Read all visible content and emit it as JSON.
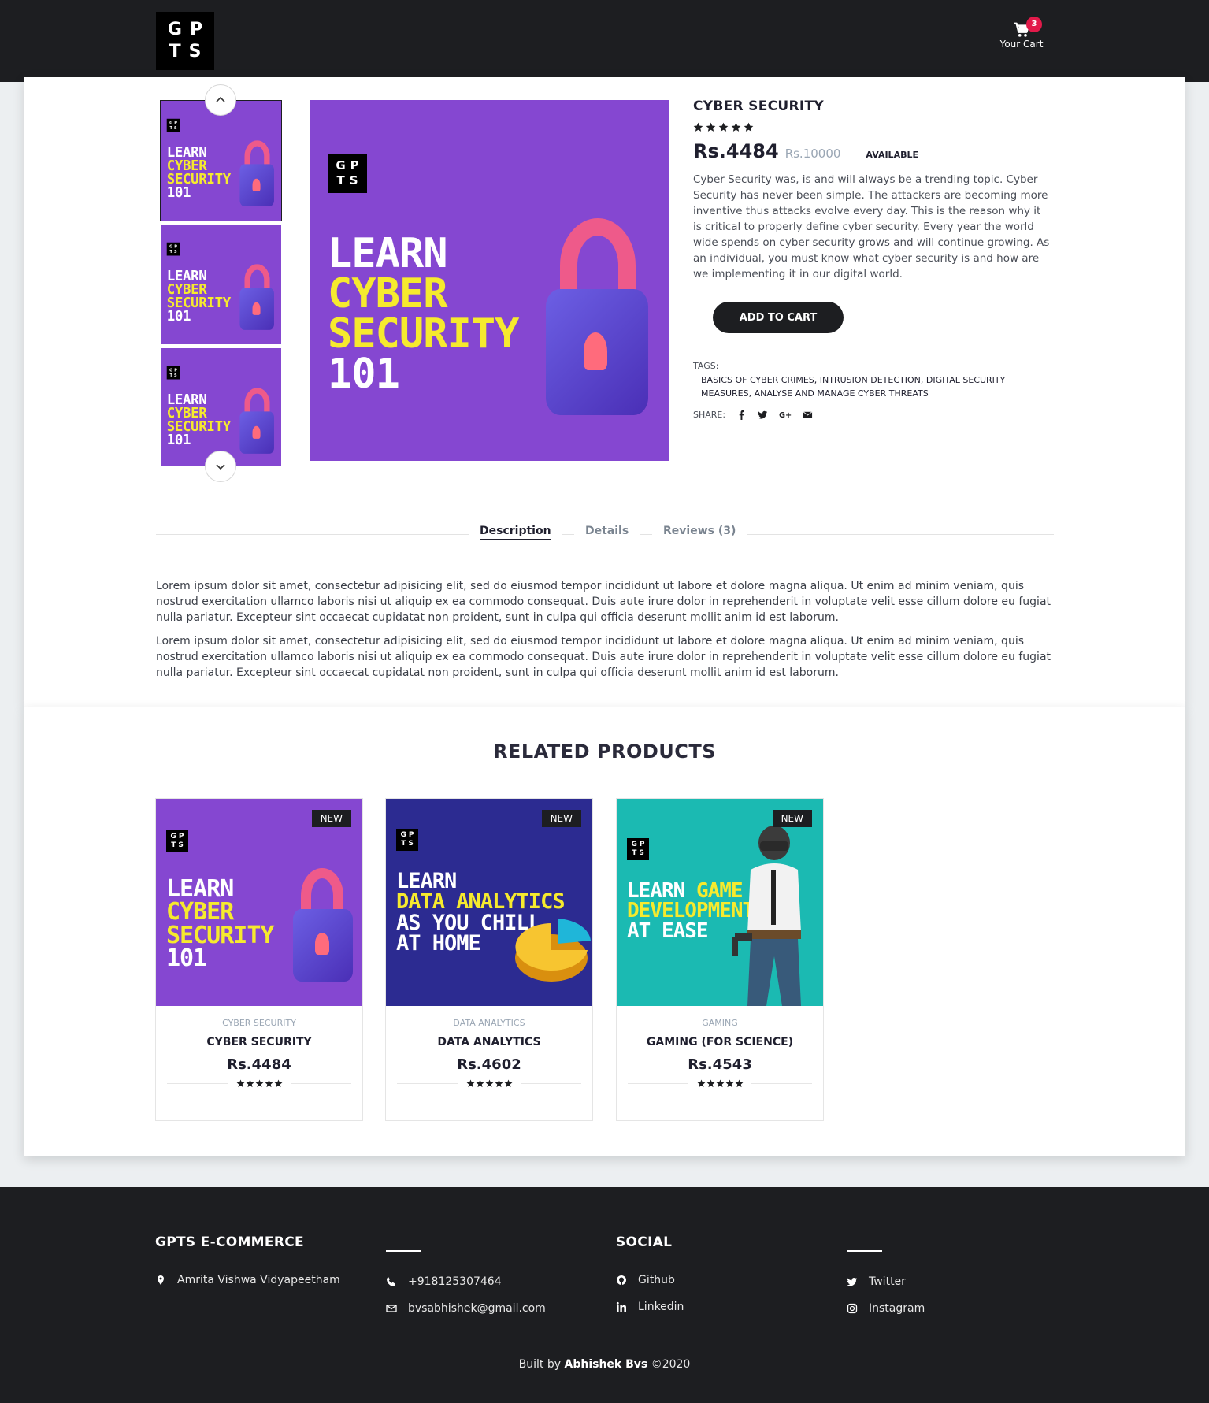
{
  "header": {
    "logo_top": "GP",
    "logo_bottom": "TS",
    "cart_label": "Your Cart",
    "cart_count": "3"
  },
  "product": {
    "title": "CYBER SECURITY",
    "rating": 5,
    "price": "Rs.4484",
    "old_price": "Rs.10000",
    "availability": "AVAILABLE",
    "description": "Cyber Security was, is and will always be a trending topic. Cyber Security has never been simple. The attackers are becoming more inventive thus attacks evolve every day. This is the reason why it is critical to properly define cyber security. Every year the world wide spends on cyber security grows and will continue growing. As an individual, you must know what cyber security is and how are we implementing it in our digital world.",
    "add_to_cart": "ADD TO CART",
    "tags_label": "TAGS:",
    "tags": "BASICS OF CYBER CRIMES, INTRUSION DETECTION, DIGITAL SECURITY MEASURES, ANALYSE AND MANAGE CYBER THREATS",
    "share_label": "SHARE:",
    "poster": {
      "line1": "LEARN",
      "line2": "CYBER",
      "line3": "SECURITY",
      "line4": "101",
      "logo_top": "GP",
      "logo_bottom": "TS"
    }
  },
  "tabs": [
    {
      "label": "Description"
    },
    {
      "label": "Details"
    },
    {
      "label": "Reviews (3)"
    }
  ],
  "description_paragraphs": [
    "Lorem ipsum dolor sit amet, consectetur adipisicing elit, sed do eiusmod tempor incididunt ut labore et dolore magna aliqua. Ut enim ad minim veniam, quis nostrud exercitation ullamco laboris nisi ut aliquip ex ea commodo consequat. Duis aute irure dolor in reprehenderit in voluptate velit esse cillum dolore eu fugiat nulla pariatur. Excepteur sint occaecat cupidatat non proident, sunt in culpa qui officia deserunt mollit anim id est laborum.",
    "Lorem ipsum dolor sit amet, consectetur adipisicing elit, sed do eiusmod tempor incididunt ut labore et dolore magna aliqua. Ut enim ad minim veniam, quis nostrud exercitation ullamco laboris nisi ut aliquip ex ea commodo consequat. Duis aute irure dolor in reprehenderit in voluptate velit esse cillum dolore eu fugiat nulla pariatur. Excepteur sint occaecat cupidatat non proident, sunt in culpa qui officia deserunt mollit anim id est laborum."
  ],
  "related": {
    "title": "RELATED PRODUCTS",
    "items": [
      {
        "badge": "NEW",
        "category": "CYBER SECURITY",
        "name": "CYBER SECURITY",
        "price": "Rs.4484",
        "rating": 5,
        "poster": [
          "LEARN",
          "CYBER",
          "SECURITY",
          "101"
        ]
      },
      {
        "badge": "NEW",
        "category": "DATA ANALYTICS",
        "name": "DATA ANALYTICS",
        "price": "Rs.4602",
        "rating": 5,
        "poster": [
          "LEARN",
          "DATA ANALYTICS",
          "AS YOU CHILL",
          "AT HOME"
        ]
      },
      {
        "badge": "NEW",
        "category": "GAMING",
        "name": "GAMING (FOR SCIENCE)",
        "price": "Rs.4543",
        "rating": 5,
        "poster": [
          "LEARN",
          "GAME",
          "DEVELOPMENT",
          "AT EASE"
        ]
      }
    ]
  },
  "footer": {
    "brand": "GPTS E-COMMERCE",
    "address": "Amrita Vishwa Vidyapeetham",
    "phone": "+918125307464",
    "email": "bvsabhishek@gmail.com",
    "social_title": "SOCIAL",
    "github": "Github",
    "linkedin": "Linkedin",
    "twitter": "Twitter",
    "instagram": "Instagram",
    "credit_prefix": "Built by",
    "credit_name": "Abhishek Bvs",
    "credit_suffix": "©2020"
  },
  "colors": {
    "dark": "#1d1e21",
    "badge_red": "#e21a4a",
    "poster_purple": "#8547d1",
    "poster_navy": "#2c2b91",
    "poster_teal": "#1bbab2",
    "poster_yellow": "#f6ea2e"
  }
}
